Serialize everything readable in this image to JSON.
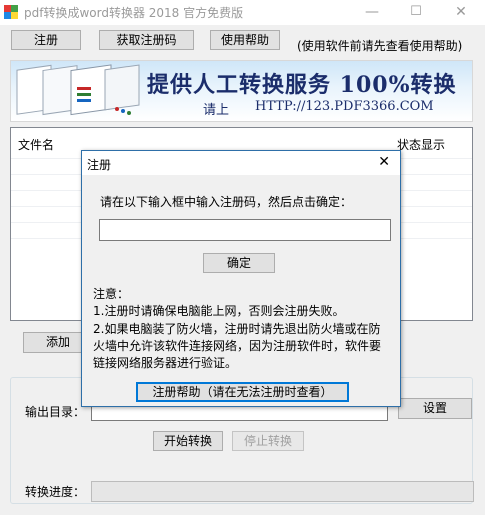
{
  "window": {
    "title": "pdf转换成word转换器 2018 官方免费版",
    "minimize_glyph": "—",
    "maximize_glyph": "☐",
    "close_glyph": "✕",
    "icon": "pdf-app-icon",
    "icon_colors": [
      "#e53935",
      "#43a047",
      "#1e88e5",
      "#fdd835"
    ]
  },
  "toolbar": {
    "register_label": "注册",
    "get_code_label": "获取注册码",
    "help_label": "使用帮助",
    "help_note": "(使用软件前请先查看使用帮助)"
  },
  "banner": {
    "headline": "提供人工转换服务 100%转换",
    "sub_label": "请上",
    "url": "HTTP://123.PDF3366.COM"
  },
  "file_list": {
    "columns": [
      "文件名",
      "状态显示"
    ]
  },
  "actions": {
    "add_label": "添加"
  },
  "output": {
    "dir_label": "输出目录：",
    "dir_value": "",
    "settings_label": "设置",
    "start_label": "开始转换",
    "stop_label": "停止转换",
    "progress_label": "转换进度：",
    "progress_value": 0
  },
  "dialog": {
    "title": "注册",
    "close_glyph": "✕",
    "prompt": "请在以下输入框中输入注册码，然后点击确定：",
    "code_value": "",
    "ok_label": "确定",
    "note_title": "注意：",
    "note_1": "1.注册时请确保电脑能上网，否则会注册失败。",
    "note_2_line1": "2.如果电脑装了防火墙，注册时请先退出防火墙或在防",
    "note_2_line2": "火墙中允许该软件连接网络，因为注册软件时，软件要",
    "note_2_line3": "链接网络服务器进行验证。",
    "help_button_label": "注册帮助（请在无法注册时查看）"
  },
  "colors": {
    "accent": "#0078d7",
    "banner_text": "#1b2d6b",
    "dialog_border": "#2e6fa8"
  }
}
